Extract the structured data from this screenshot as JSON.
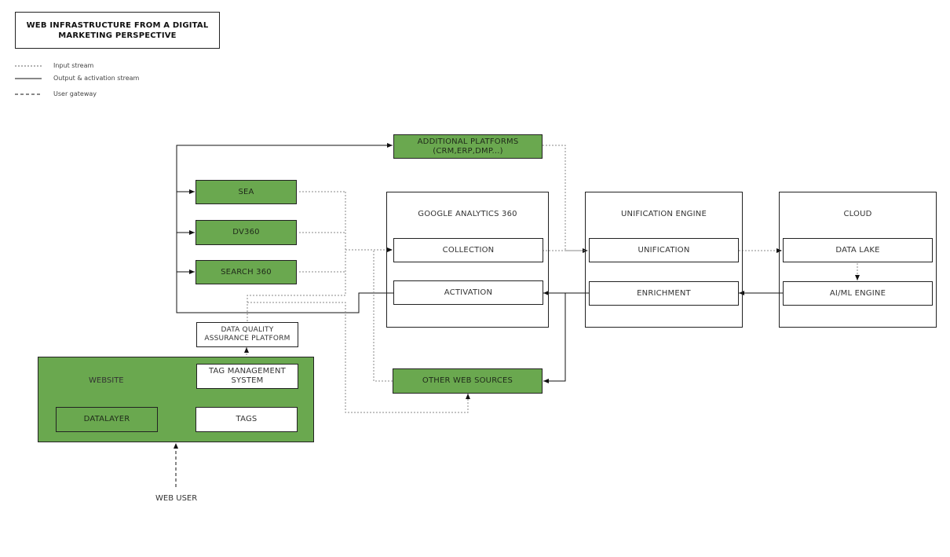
{
  "title": "WEB INFRASTRUCTURE FROM A DIGITAL MARKETING PERSPECTIVE",
  "legend": [
    {
      "label": "Input stream",
      "style": "dotted"
    },
    {
      "label": "Output & activation stream",
      "style": "solid"
    },
    {
      "label": "User gateway",
      "style": "dashed"
    }
  ],
  "colors": {
    "green": "#6aa84f",
    "line": "#222222",
    "dotted": "#888888"
  },
  "nodes": {
    "additional_platforms": "ADDITIONAL PLATFORMS\n(CRM,ERP,DMP...)",
    "sea": "SEA",
    "dv360": "DV360",
    "search360": "SEARCH 360",
    "ga360": "GOOGLE ANALYTICS 360",
    "collection": "COLLECTION",
    "activation": "ACTIVATION",
    "unification_engine": "UNIFICATION ENGINE",
    "unification": "UNIFICATION",
    "enrichment": "ENRICHMENT",
    "cloud": "CLOUD",
    "data_lake": "DATA LAKE",
    "aiml_engine": "AI/ML ENGINE",
    "dqap": "DATA QUALITY\nASSURANCE PLATFORM",
    "website": "WEBSITE",
    "tms": "TAG MANAGEMENT\nSYSTEM",
    "datalayer": "DATALAYER",
    "tags": "TAGS",
    "other_web_sources": "OTHER WEB SOURCES",
    "web_user": "WEB USER"
  }
}
